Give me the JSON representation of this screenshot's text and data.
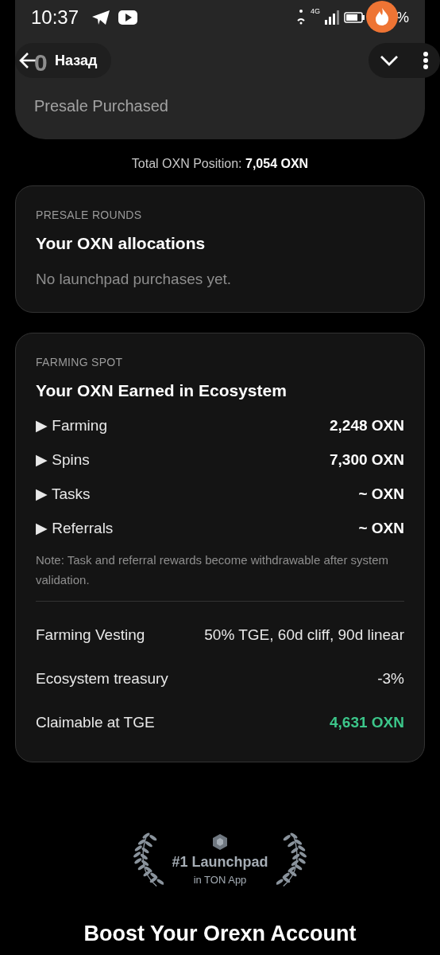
{
  "status_bar": {
    "time": "10:37",
    "network": "4G",
    "battery": "%"
  },
  "header": {
    "back": "Назад",
    "amount": "0"
  },
  "summary": {
    "label": "Presale Purchased",
    "total_label": "Total OXN Position: ",
    "total_value": "7,054 OXN"
  },
  "presale": {
    "eyebrow": "PRESALE ROUNDS",
    "title": "Your OXN allocations",
    "empty": "No launchpad purchases yet."
  },
  "farming": {
    "eyebrow": "FARMING SPOT",
    "title": "Your OXN Earned in Ecosystem",
    "earnings": [
      {
        "label": "▶ Farming",
        "value": "2,248 OXN"
      },
      {
        "label": "▶ Spins",
        "value": "7,300 OXN"
      },
      {
        "label": "▶ Tasks",
        "value": "~ OXN"
      },
      {
        "label": "▶ Referrals",
        "value": "~ OXN"
      }
    ],
    "note": "Note: Task and referral rewards become withdrawable after system validation.",
    "details": [
      {
        "label": "Farming Vesting",
        "value": "50% TGE, 60d cliff, 90d linear",
        "highlight": false
      },
      {
        "label": "Ecosystem treasury",
        "value": "-3%",
        "highlight": false
      },
      {
        "label": "Claimable at TGE",
        "value": "4,631 OXN",
        "highlight": true
      }
    ]
  },
  "badge": {
    "title": "#1 Launchpad",
    "subtitle": "in TON App"
  },
  "boost": {
    "heading": "Boost Your Orexn Account"
  }
}
